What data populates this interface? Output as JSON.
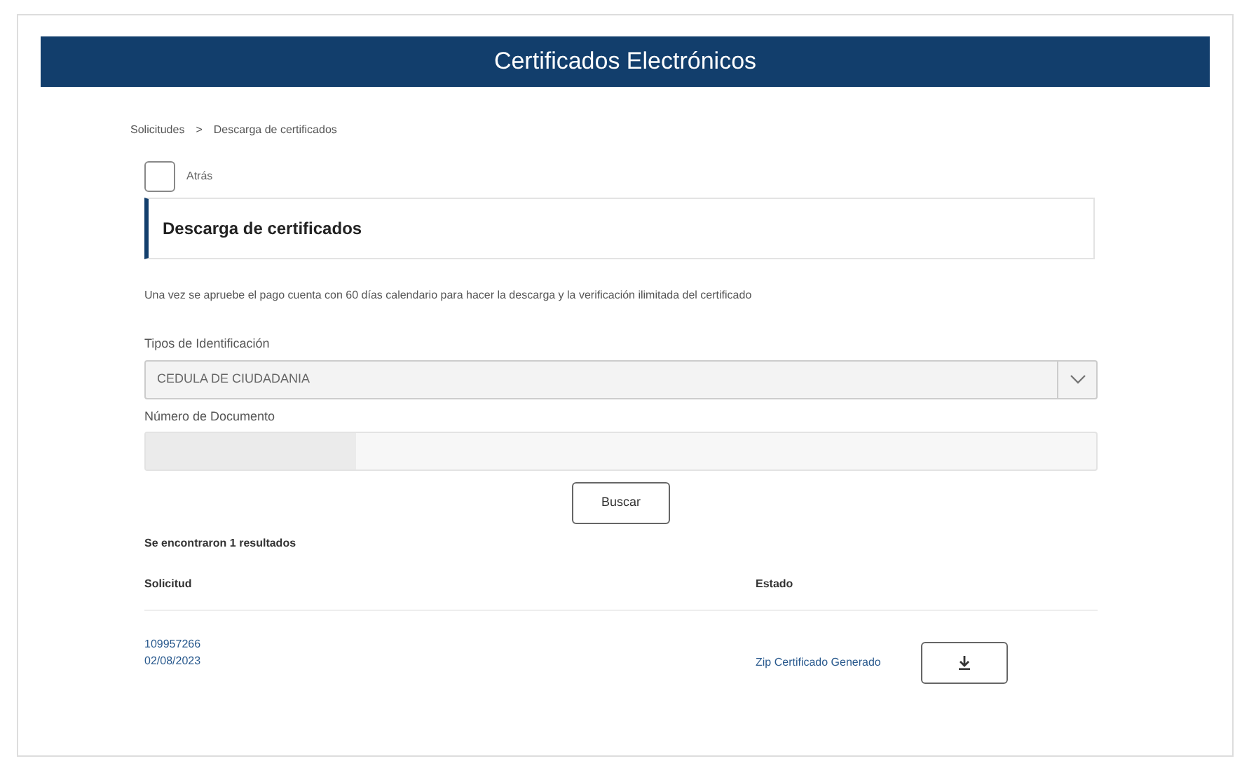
{
  "header": {
    "title": "Certificados Electrónicos"
  },
  "breadcrumb": [
    "Solicitudes",
    "Descarga de certificados"
  ],
  "breadcrumb_separator": ">",
  "back": {
    "label": "Atrás"
  },
  "section_title": "Descarga de certificados",
  "notice": "Una vez se apruebe el pago cuenta con 60 días calendario para hacer la descarga y la verificación ilimitada del certificado",
  "id_type": {
    "label": "Tipos de Identificación",
    "value": "CEDULA DE CIUDADANIA"
  },
  "doc_number": {
    "label": "Número de Documento"
  },
  "search_button": "Buscar",
  "results_count": "Se encontraron 1 resultados",
  "table": {
    "columns": [
      "Solicitud",
      "Estado"
    ],
    "rows": [
      {
        "request": "109957266",
        "date": "02/08/2023",
        "status": "Zip Certificado Generado"
      }
    ]
  }
}
